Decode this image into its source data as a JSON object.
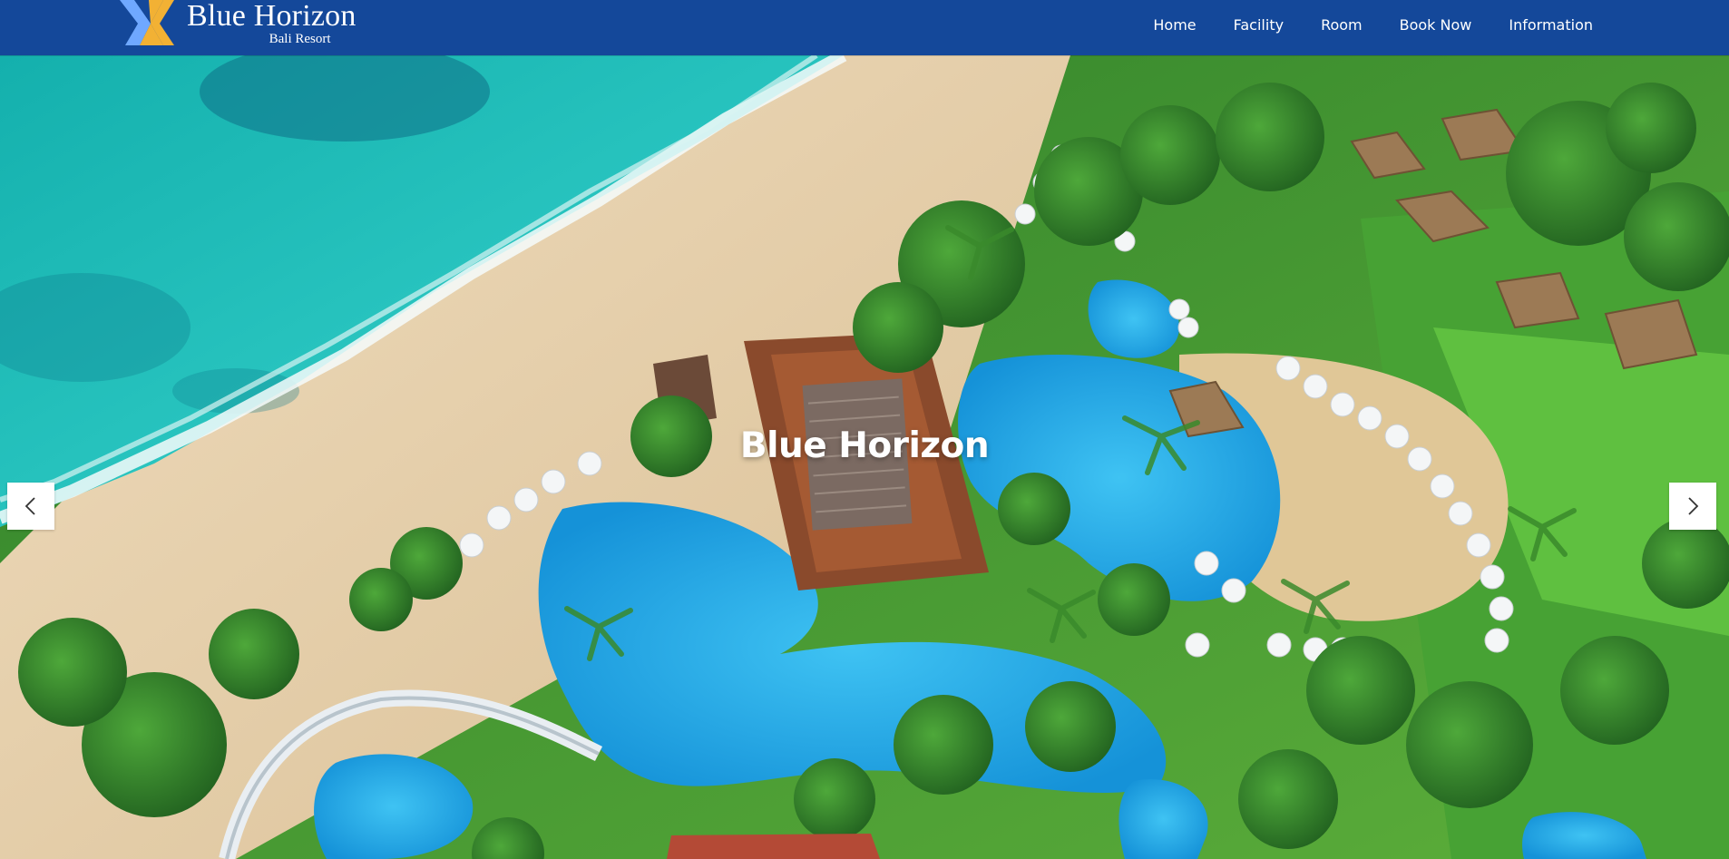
{
  "brand": {
    "name": "Blue Horizon",
    "subtitle": "Bali Resort",
    "logo_colors": [
      "#6fa8ff",
      "#f2b134"
    ]
  },
  "nav": {
    "items": [
      {
        "label": "Home"
      },
      {
        "label": "Facility"
      },
      {
        "label": "Room"
      },
      {
        "label": "Book Now"
      },
      {
        "label": "Information"
      }
    ]
  },
  "hero": {
    "title": "Blue Horizon",
    "prev_icon": "chevron-left-icon",
    "next_icon": "chevron-right-icon"
  },
  "colors": {
    "navbar": "#14489a",
    "nav_text": "#ffffff",
    "ocean": "#1fb9b6",
    "sand": "#e7cfa9",
    "pool": "#23a6e6",
    "grass": "#3f9b32"
  }
}
